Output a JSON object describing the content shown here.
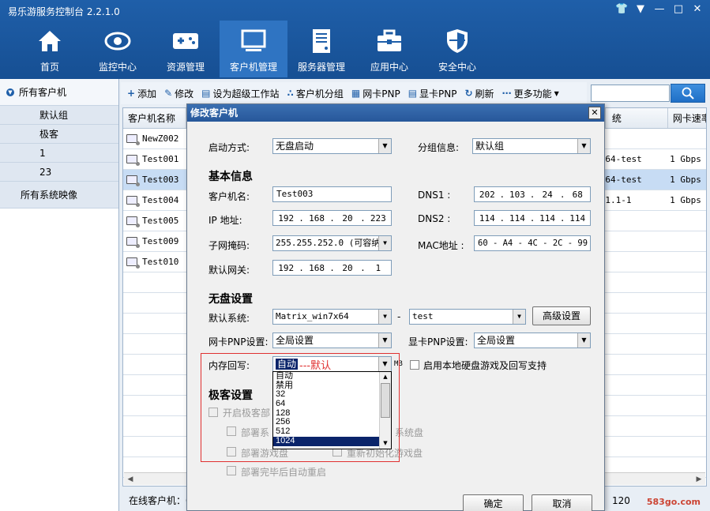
{
  "app": {
    "title": "易乐游服务控制台 2.2.1.0"
  },
  "nav": [
    {
      "label": "首页",
      "icon": "home-icon"
    },
    {
      "label": "监控中心",
      "icon": "eye-icon"
    },
    {
      "label": "资源管理",
      "icon": "gamepad-icon"
    },
    {
      "label": "客户机管理",
      "icon": "monitor-icon"
    },
    {
      "label": "服务器管理",
      "icon": "server-icon"
    },
    {
      "label": "应用中心",
      "icon": "toolbox-icon"
    },
    {
      "label": "安全中心",
      "icon": "shield-icon"
    }
  ],
  "sidebar": {
    "all_clients": "所有客户机",
    "groups": [
      "默认组",
      "极客",
      "1",
      "23"
    ],
    "all_images": "所有系统映像"
  },
  "toolbar": {
    "add": "添加",
    "edit": "修改",
    "set_super": "设为超级工作站",
    "group": "客户机分组",
    "nic_pnp": "网卡PNP",
    "gpu_pnp": "显卡PNP",
    "refresh": "刷新",
    "more": "更多功能"
  },
  "table": {
    "headers": [
      "客户机名称",
      "统",
      "网卡速率"
    ],
    "rows": [
      {
        "name": "NewZ002",
        "sys": "",
        "speed": ""
      },
      {
        "name": "Test001",
        "sys": "64-test",
        "speed": "1 Gbps"
      },
      {
        "name": "Test003",
        "sys": "64-test",
        "speed": "1 Gbps"
      },
      {
        "name": "Test004",
        "sys": "1.1-1",
        "speed": "1 Gbps"
      },
      {
        "name": "Test005",
        "sys": "",
        "speed": ""
      },
      {
        "name": "Test009",
        "sys": "",
        "speed": ""
      },
      {
        "name": "Test010",
        "sys": "",
        "speed": ""
      }
    ]
  },
  "status": {
    "online_label": "在线客户机：0",
    "right_value": "120",
    "watermark": "583go.com"
  },
  "dialog": {
    "title": "修改客户机",
    "boot_label": "启动方式:",
    "boot_value": "无盘启动",
    "group_label": "分组信息:",
    "group_value": "默认组",
    "basic_section": "基本信息",
    "name_label": "客户机名:",
    "name_value": "Test003",
    "ip_label": "IP  地址:",
    "ip": [
      "192",
      "168",
      "20",
      "223"
    ],
    "mask_label": "子网掩码:",
    "mask_value": "255.255.252.0   (可容纳",
    "gateway_label": "默认网关:",
    "gateway": [
      "192",
      "168",
      "20",
      "1"
    ],
    "dns1_label": "DNS1  :",
    "dns1": [
      "202",
      "103",
      "24",
      "68"
    ],
    "dns2_label": "DNS2  :",
    "dns2": [
      "114",
      "114",
      "114",
      "114"
    ],
    "mac_label": "MAC地址 :",
    "mac_value": "60 - A4 - 4C - 2C - 99 - 83",
    "diskless_section": "无盘设置",
    "default_sys_label": "默认系统:",
    "default_sys_value": "Matrix_win7x64",
    "dash": "-",
    "sys2_value": "test",
    "advanced_btn": "高级设置",
    "nic_pnp_label": "网卡PNP设置:",
    "nic_pnp_value": "全局设置",
    "gpu_pnp_label": "显卡PNP设置:",
    "gpu_pnp_value": "全局设置",
    "mem_label": "内存回写:",
    "mem_value": "自动",
    "mem_note": "---默认",
    "mb": "MB",
    "local_disk_label": "启用本地硬盘游戏及回写支持",
    "geek_section": "极客设置",
    "enable_geek": "开启极客部",
    "deploy_sys": "部署系",
    "sys_disk": "系统盘",
    "deploy_game": "部署游戏盘",
    "reinit_game": "重新初始化游戏盘",
    "auto_reboot": "部署完毕后自动重启",
    "ok": "确定",
    "cancel": "取消",
    "mem_options": [
      "自动",
      "禁用",
      "32",
      "64",
      "128",
      "256",
      "512",
      "1024"
    ],
    "mem_highlight": "1024"
  }
}
